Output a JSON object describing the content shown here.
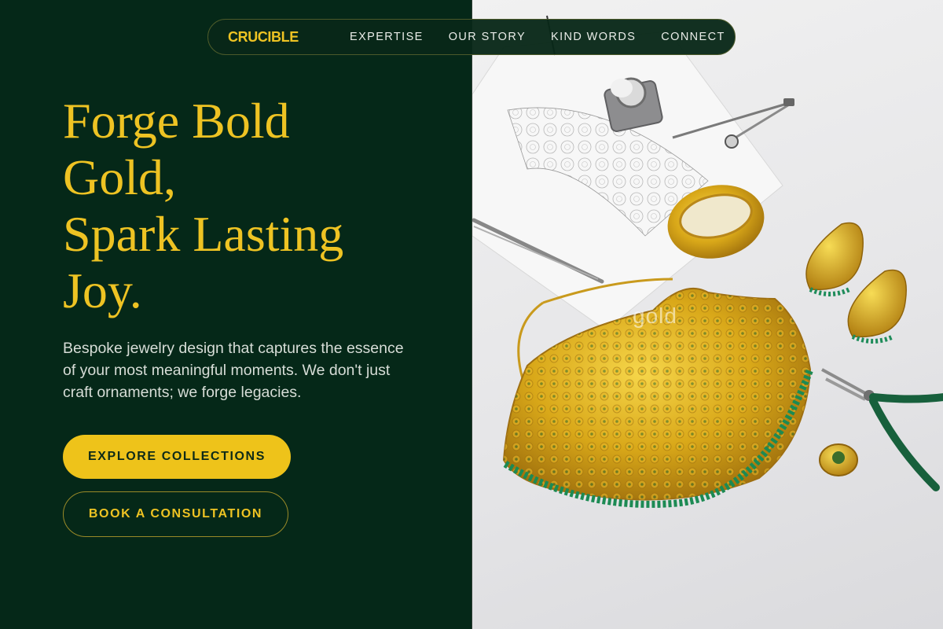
{
  "brand": {
    "name": "CRUCIBLE"
  },
  "nav": {
    "links": [
      "EXPERTISE",
      "OUR STORY",
      "KIND WORDS",
      "CONNECT"
    ]
  },
  "hero": {
    "title_lines": [
      "Forge Bold",
      "Gold,",
      "Spark Lasting",
      "Joy."
    ],
    "subtitle": "Bespoke jewelry design that captures the essence of your most meaningful moments. We don't just craft ornaments; we forge legacies.",
    "primary_cta": "EXPLORE COLLECTIONS",
    "secondary_cta": "BOOK A CONSULTATION"
  },
  "image": {
    "watermark": "gold",
    "subject": "gold necklace with green beads, bangle, earrings, ring, sketch, loupe, compass, tweezers and pliers"
  },
  "colors": {
    "panel_green": "#052818",
    "accent_gold": "#eec323",
    "text_light": "#d7ddd7"
  }
}
